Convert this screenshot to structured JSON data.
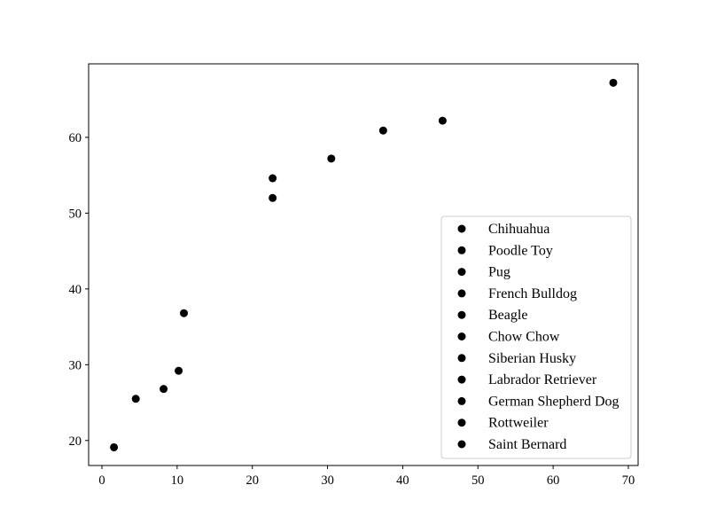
{
  "chart_data": {
    "type": "scatter",
    "title": "",
    "xlabel": "",
    "ylabel": "",
    "xlim": [
      -1.77,
      71.3
    ],
    "ylim": [
      16.7,
      69.7
    ],
    "xticks": [
      0,
      10,
      20,
      30,
      40,
      50,
      60,
      70
    ],
    "yticks": [
      20,
      30,
      40,
      50,
      60
    ],
    "grid": false,
    "legend_position": "lower-right",
    "marker_color": "#000000",
    "series": [
      {
        "name": "Chihuahua",
        "x": 1.6,
        "y": 19.1
      },
      {
        "name": "Poodle Toy",
        "x": 4.5,
        "y": 25.5
      },
      {
        "name": "Pug",
        "x": 8.2,
        "y": 26.8
      },
      {
        "name": "French Bulldog",
        "x": 10.2,
        "y": 29.2
      },
      {
        "name": "Beagle",
        "x": 10.9,
        "y": 36.8
      },
      {
        "name": "Chow Chow",
        "x": 22.7,
        "y": 52.0
      },
      {
        "name": "Siberian Husky",
        "x": 22.7,
        "y": 54.6
      },
      {
        "name": "Labrador Retriever",
        "x": 30.5,
        "y": 57.2
      },
      {
        "name": "German Shepherd Dog",
        "x": 37.4,
        "y": 60.9
      },
      {
        "name": "Rottweiler",
        "x": 45.3,
        "y": 62.2
      },
      {
        "name": "Saint Bernard",
        "x": 68.0,
        "y": 67.2
      }
    ]
  }
}
